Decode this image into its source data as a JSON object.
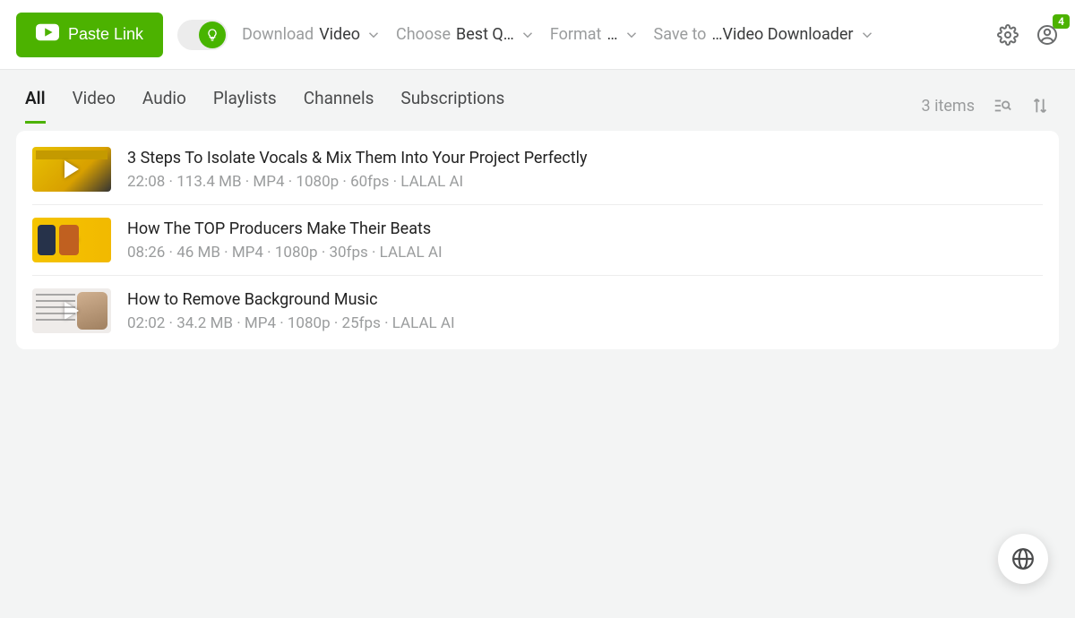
{
  "toolbar": {
    "paste_label": "Paste Link",
    "download_label": "Download",
    "download_value": "Video",
    "choose_label": "Choose",
    "choose_value": "Best Q…",
    "format_label": "Format",
    "format_value": "…",
    "saveto_label": "Save to",
    "saveto_value": "…Video Downloader",
    "notification_count": "4"
  },
  "tabs": {
    "items": [
      "All",
      "Video",
      "Audio",
      "Playlists",
      "Channels",
      "Subscriptions"
    ],
    "active_index": 0,
    "count_label": "3 items"
  },
  "list": [
    {
      "title": "3 Steps To Isolate Vocals & Mix Them Into Your Project Perfectly",
      "meta": "22:08 · 113.4 MB · MP4 · 1080p · 60fps · LALAL AI",
      "thumb_class": "th1"
    },
    {
      "title": "How The TOP Producers Make Their Beats",
      "meta": "08:26 · 46 MB · MP4 · 1080p · 30fps · LALAL AI",
      "thumb_class": "th2"
    },
    {
      "title": "How to Remove Background Music",
      "meta": "02:02 · 34.2 MB · MP4 · 1080p · 25fps · LALAL AI",
      "thumb_class": "th3"
    }
  ]
}
